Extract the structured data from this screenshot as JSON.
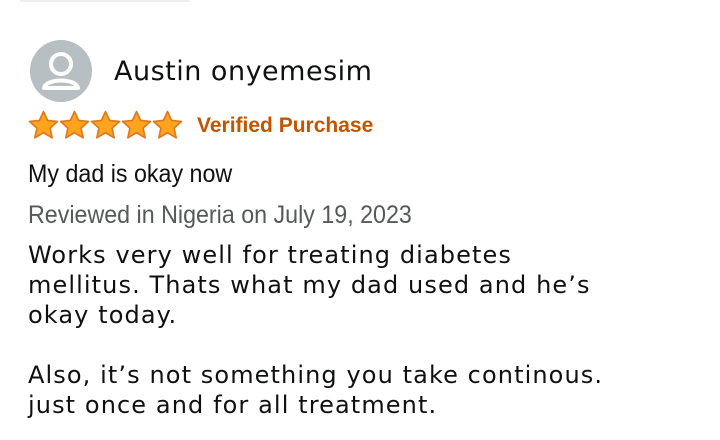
{
  "reviewer": {
    "name": "Austin onyemesim",
    "avatar_icon": "default-user-avatar-icon"
  },
  "rating": {
    "stars": 5,
    "max_stars": 5,
    "star_color": "#ffa41c",
    "star_outline_color": "#de7921",
    "verified_label": "Verified Purchase",
    "verified_color": "#c45500"
  },
  "review": {
    "title": "My dad is okay now",
    "meta": "Reviewed in Nigeria on July 19, 2023",
    "body_paragraph_1": "Works very well for treating diabetes\nmellitus. Thats what my dad used and he’s\nokay today.",
    "body_paragraph_2": "Also, it’s not something you take continous.\njust once and for all treatment."
  }
}
